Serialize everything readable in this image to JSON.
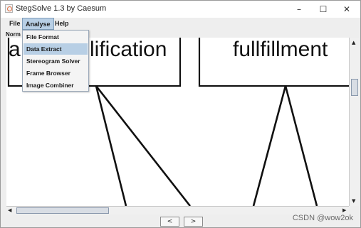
{
  "window": {
    "title": "StegSolve 1.3 by Caesum",
    "controls": {
      "minimize": "–",
      "maximize": "☐",
      "close": "✕"
    }
  },
  "menubar": {
    "items": [
      {
        "label": "File"
      },
      {
        "label": "Analyse"
      },
      {
        "label": "Help"
      }
    ],
    "active": "Analyse"
  },
  "toolbar": {
    "label": "Norm"
  },
  "analyse_menu": {
    "items": [
      {
        "label": "File Format"
      },
      {
        "label": "Data Extract"
      },
      {
        "label": "Stereogram Solver"
      },
      {
        "label": "Frame Browser"
      },
      {
        "label": "Image Combiner"
      }
    ],
    "highlighted": "Data Extract"
  },
  "canvas": {
    "words": {
      "left_fragment": "a",
      "left_word": "lification",
      "right_word": "fullfillment"
    }
  },
  "navigation": {
    "prev_label": "<",
    "next_label": ">"
  },
  "watermark": "CSDN @wow2ok"
}
